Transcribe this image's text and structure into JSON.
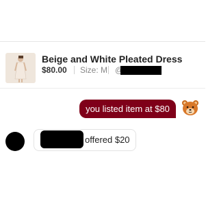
{
  "listing": {
    "title": "Beige and White Pleated Dress",
    "price": "$80.00",
    "size": "Size: M",
    "seller_prefix": "@"
  },
  "messages": [
    {
      "sender": "me",
      "text": "you listed item at $80"
    },
    {
      "sender": "other",
      "text": "offered $20"
    }
  ],
  "colors": {
    "my_bubble": "#7f0019",
    "divider": "#e6e6e6"
  },
  "icons": {
    "my_avatar": "bear-avatar-icon",
    "other_avatar": "profile-avatar"
  }
}
